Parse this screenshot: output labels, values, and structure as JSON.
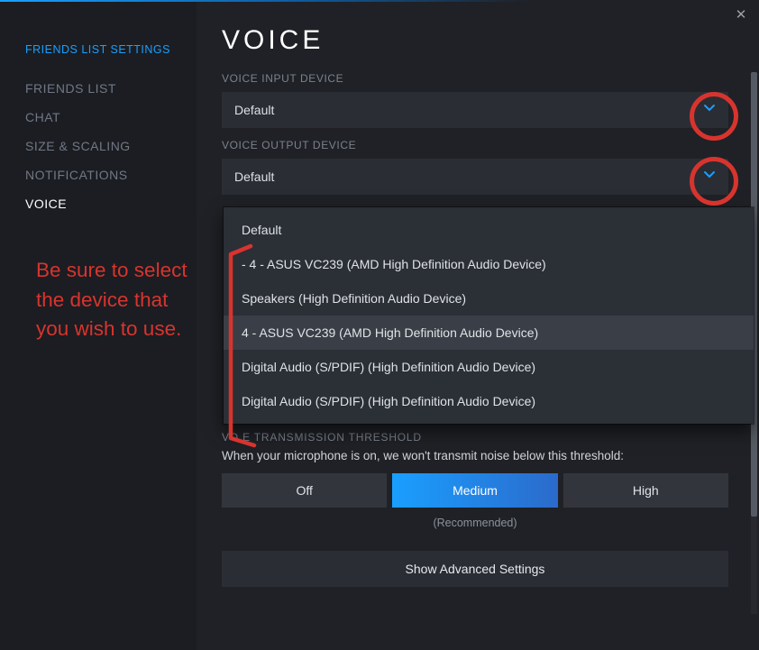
{
  "sidebar": {
    "title": "FRIENDS LIST SETTINGS",
    "items": [
      {
        "label": "FRIENDS LIST",
        "active": false
      },
      {
        "label": "CHAT",
        "active": false
      },
      {
        "label": "SIZE & SCALING",
        "active": false
      },
      {
        "label": "NOTIFICATIONS",
        "active": false
      },
      {
        "label": "VOICE",
        "active": true
      }
    ]
  },
  "main": {
    "title": "VOICE",
    "input_label": "VOICE INPUT DEVICE",
    "input_value": "Default",
    "output_label": "VOICE OUTPUT DEVICE",
    "output_value": "Default",
    "output_options": [
      "Default",
      "- 4 - ASUS VC239 (AMD High Definition Audio Device)",
      "Speakers (High Definition Audio Device)",
      "4 - ASUS VC239 (AMD High Definition Audio Device)",
      "Digital Audio (S/PDIF) (High Definition Audio Device)",
      "Digital Audio (S/PDIF) (High Definition Audio Device)"
    ],
    "output_highlight_index": 3,
    "threshold_heading_obscured": "VO    E TRANSMISSION THRESHOLD",
    "threshold_desc": "When your microphone is on, we won't transmit noise below this threshold:",
    "threshold_options": [
      "Off",
      "Medium",
      "High"
    ],
    "threshold_selected_index": 1,
    "recommended_text": "(Recommended)",
    "advanced_button": "Show Advanced Settings"
  },
  "annotation": {
    "text": "Be sure to select the device that you wish to use."
  },
  "colors": {
    "accent": "#1a9fff",
    "annotation": "#d8342e"
  }
}
